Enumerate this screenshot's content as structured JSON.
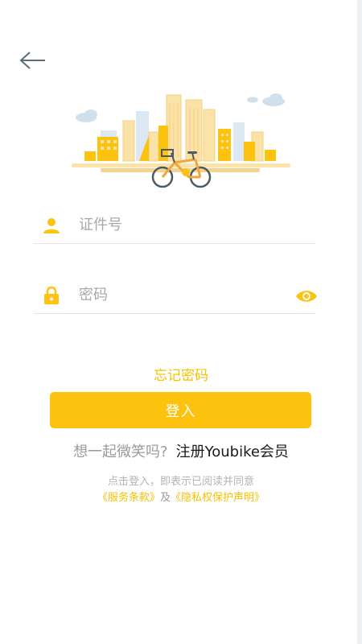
{
  "header": {
    "back_icon": "arrow-left-icon"
  },
  "illustration": {
    "name": "city-bike-illustration",
    "colors": {
      "accent": "#fcc20d",
      "building_light": "#fbe3a8",
      "cloud": "#cfe0ec",
      "bike_frame": "#f2a53a",
      "wheel": "#4a5b66"
    }
  },
  "form": {
    "id_field": {
      "icon": "user-icon",
      "placeholder": "证件号",
      "value": ""
    },
    "password_field": {
      "icon": "lock-icon",
      "placeholder": "密码",
      "value": "",
      "toggle_icon": "eye-icon"
    },
    "forgot_label": "忘记密码",
    "login_label": "登入"
  },
  "register": {
    "prompt": "想一起微笑吗?",
    "link": "注册Youbike会员"
  },
  "agreement": {
    "line1": "点击登入，即表示已阅读并同意",
    "terms_link": "《服务条款》",
    "conjunction": "及",
    "privacy_link": "《隐私权保护声明》"
  },
  "colors": {
    "accent": "#fcc20d",
    "link_yellow": "#f5c200",
    "placeholder": "#a8a8a8",
    "divider": "#e3e3e3"
  }
}
